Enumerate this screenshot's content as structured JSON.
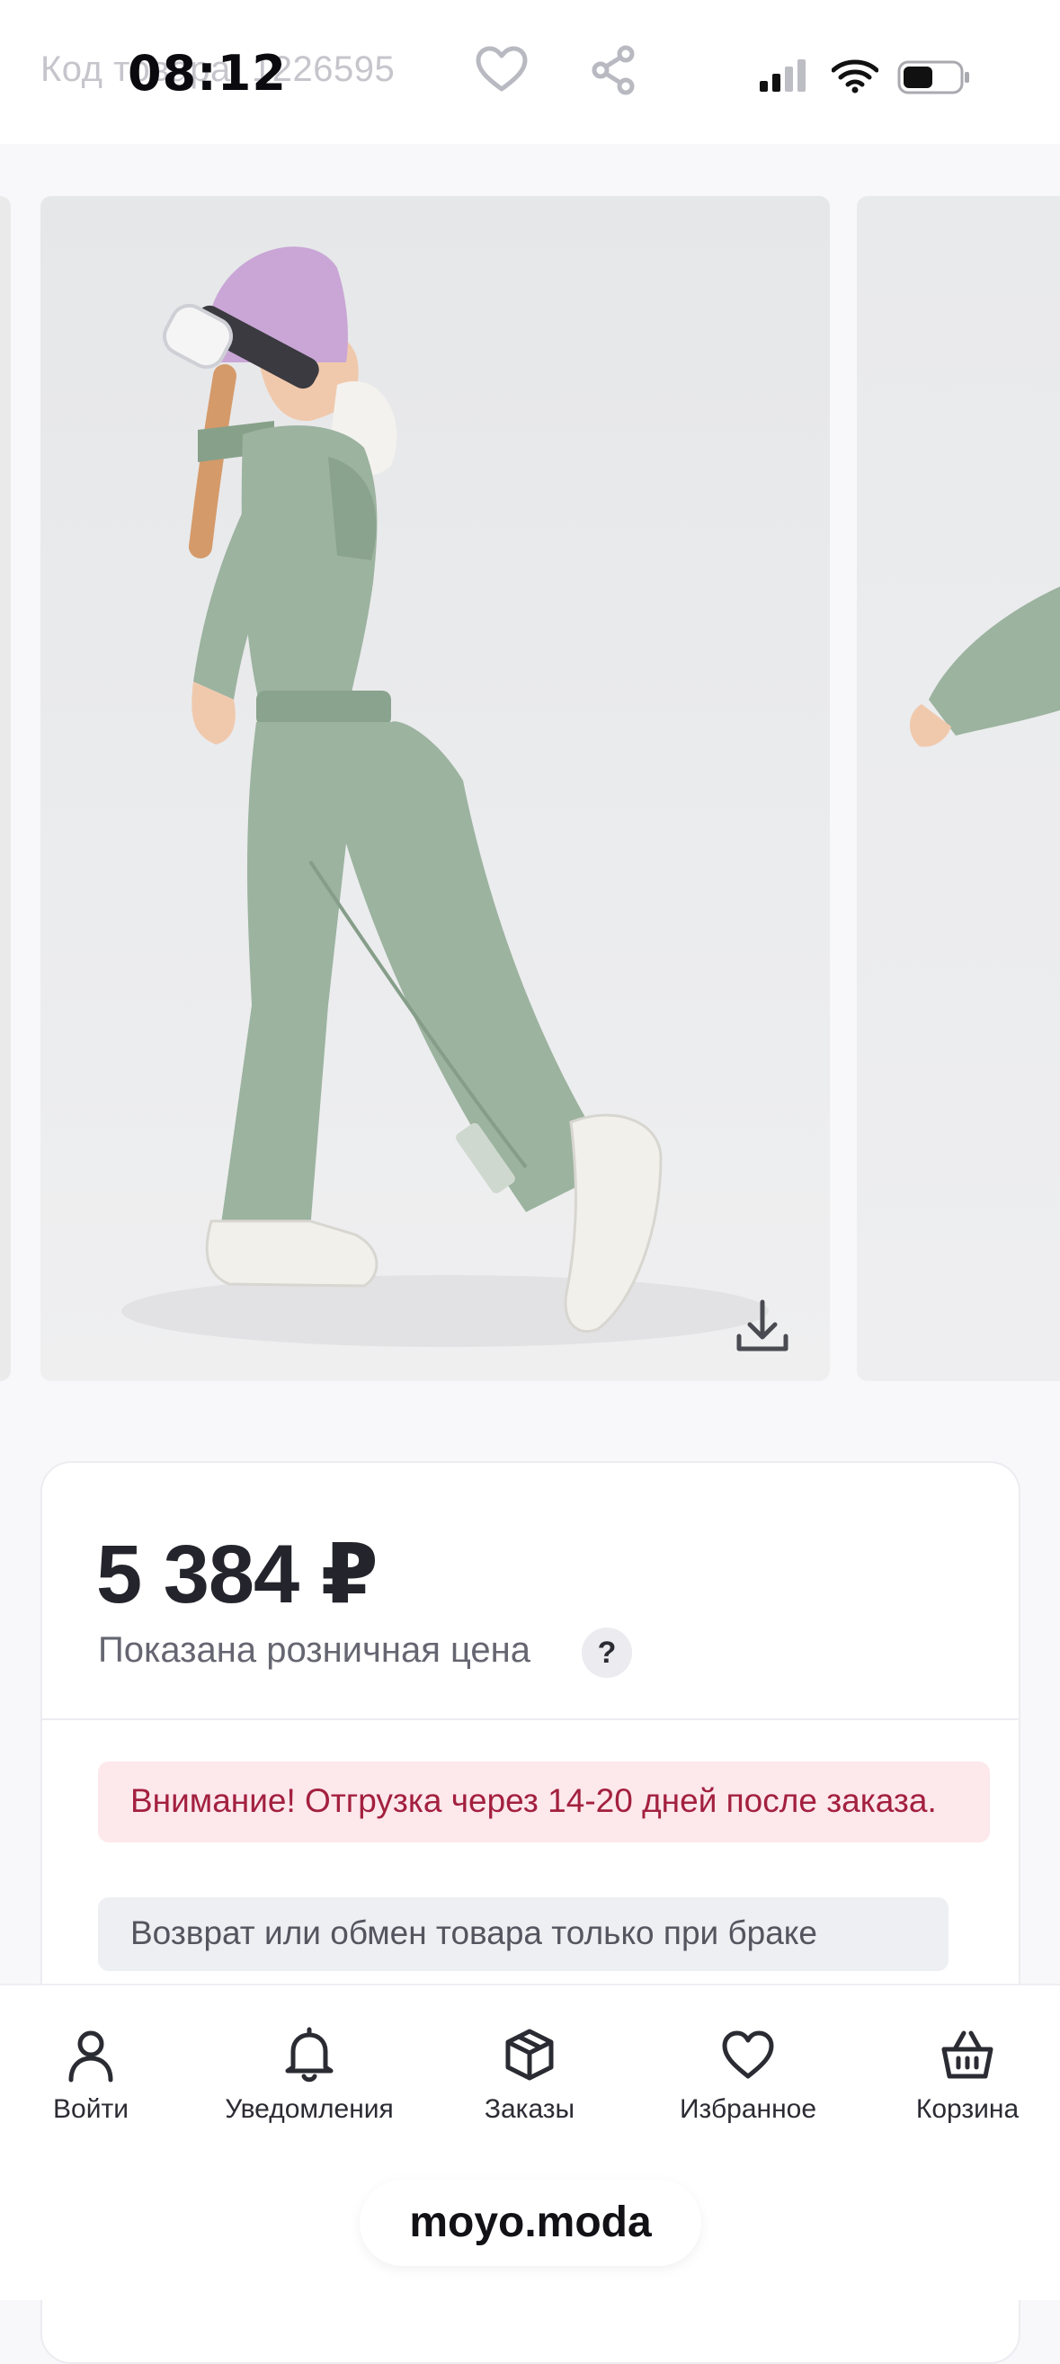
{
  "status": {
    "time": "08:12",
    "product_code_label": "Код товара",
    "product_code": "1226595"
  },
  "header": {
    "favorite_icon": "heart-outline-icon",
    "share_icon": "share-icon"
  },
  "gallery": {
    "images": [
      "girl-in-sage-green-snowsuit-side",
      "girl-in-sage-green-snowsuit-arm"
    ],
    "download_icon": "download-icon"
  },
  "product": {
    "price": "5 384 ₽",
    "price_note": "Показана розничная цена",
    "help": "?",
    "alert": "Внимание! Отгрузка через 14-20 дней после заказа.",
    "return_note": "Возврат или обмен товара только при браке"
  },
  "tabbar": {
    "items": [
      {
        "label": "Войти",
        "icon": "user-icon"
      },
      {
        "label": "Уведомления",
        "icon": "bell-icon"
      },
      {
        "label": "Заказы",
        "icon": "box-icon"
      },
      {
        "label": "Избранное",
        "icon": "heart-icon"
      },
      {
        "label": "Корзина",
        "icon": "basket-icon"
      }
    ]
  },
  "browser": {
    "url": "moyo.moda"
  },
  "colors": {
    "accent_alert_bg": "#fde8ec",
    "accent_alert_text": "#a3203f",
    "snowsuit": "#9cb39f",
    "hat": "#c9a6d6"
  }
}
